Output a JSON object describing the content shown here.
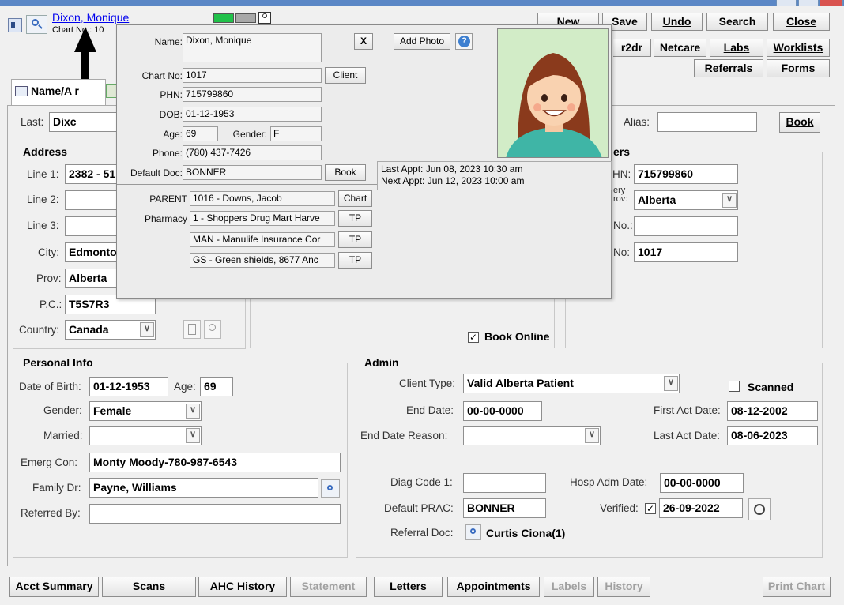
{
  "window": {
    "title_link": "Dixon, Monique",
    "chart_no_label": "Chart No.: 10"
  },
  "toolbar": {
    "new": "New",
    "save": "Save",
    "undo": "Undo",
    "search": "Search",
    "close": "Close",
    "r2dr": "r2dr",
    "netcare": "Netcare",
    "labs": "Labs",
    "worklists": "Worklists",
    "referrals": "Referrals",
    "forms": "Forms"
  },
  "tabs": {
    "name_addr": "Name/A   r"
  },
  "top": {
    "last_label": "Last:",
    "last_value": "Dixc",
    "alias_label": "Alias:",
    "alias_value": "",
    "book": "Book"
  },
  "address": {
    "title": "Address",
    "line1_label": "Line 1:",
    "line1_value": "2382 - 51",
    "line2_label": "Line 2:",
    "line3_label": "Line 3:",
    "city_label": "City:",
    "city_value": "Edmonto",
    "prov_label": "Prov:",
    "prov_value": "Alberta",
    "pc_label": "P.C.:",
    "pc_value": "T5S7R3",
    "country_label": "Country:",
    "country_value": "Canada"
  },
  "identifiers": {
    "title": "ers",
    "hn_label": "HN:",
    "hn_value": "715799860",
    "prov_label": "ery\nrov:",
    "prov_value": "Alberta",
    "no_label": "No.:",
    "no_value": "",
    "chart_label": "No:",
    "chart_value": "1017"
  },
  "book_online": "Book Online",
  "personal": {
    "title": "Personal Info",
    "dob_label": "Date of Birth:",
    "dob_value": "01-12-1953",
    "age_label": "Age:",
    "age_value": "69",
    "gender_label": "Gender:",
    "gender_value": "Female",
    "married_label": "Married:",
    "married_value": "",
    "emerg_label": "Emerg Con:",
    "emerg_value": "Monty Moody-780-987-6543",
    "family_label": "Family Dr:",
    "family_value": "Payne, Williams",
    "referred_label": "Referred By:",
    "referred_value": ""
  },
  "admin": {
    "title": "Admin",
    "client_type_label": "Client Type:",
    "client_type_value": "Valid Alberta Patient",
    "scanned_label": "Scanned",
    "end_date_label": "End Date:",
    "end_date_value": "00-00-0000",
    "first_act_label": "First Act Date:",
    "first_act_value": "08-12-2002",
    "end_reason_label": "End Date Reason:",
    "end_reason_value": "",
    "last_act_label": "Last Act Date:",
    "last_act_value": "08-06-2023",
    "diag_label": "Diag Code 1:",
    "diag_value": "",
    "hosp_label": "Hosp Adm Date:",
    "hosp_value": "00-00-0000",
    "prac_label": "Default PRAC:",
    "prac_value": "BONNER",
    "verified_label": "Verified:",
    "verified_value": "26-09-2022",
    "referral_label": "Referral Doc:",
    "referral_value": "Curtis Ciona(1)"
  },
  "bottom": {
    "acct": "Acct Summary",
    "scans": "Scans",
    "ahc": "AHC History",
    "statement": "Statement",
    "letters": "Letters",
    "appointments": "Appointments",
    "labels": "Labels",
    "history": "History",
    "print_chart": "Print Chart"
  },
  "popup": {
    "name_label": "Name:",
    "name_value": "Dixon, Monique",
    "close": "X",
    "add_photo": "Add Photo",
    "chart_label": "Chart No:",
    "chart_value": "1017",
    "client_btn": "Client",
    "phn_label": "PHN:",
    "phn_value": "715799860",
    "dob_label": "DOB:",
    "dob_value": "01-12-1953",
    "age_label": "Age:",
    "age_value": "69",
    "gender_label": "Gender:",
    "gender_value": "F",
    "phone_label": "Phone:",
    "phone_value": "(780) 437-7426",
    "doc_label": "Default Doc:",
    "doc_value": "BONNER",
    "book_btn": "Book",
    "last_appt": "Last Appt: Jun 08, 2023 10:30 am",
    "next_appt": "Next Appt: Jun 12, 2023 10:00 am",
    "parent_label": "PARENT",
    "parent_value": "1016 - Downs, Jacob",
    "chart_btn": "Chart",
    "pharmacy_label": "Pharmacy",
    "pharmacy_value": "1 - Shoppers Drug Mart Harve",
    "ins1_value": "MAN - Manulife Insurance Cor",
    "ins2_value": "GS - Green shields, 8677 Anc",
    "tp": "TP"
  }
}
